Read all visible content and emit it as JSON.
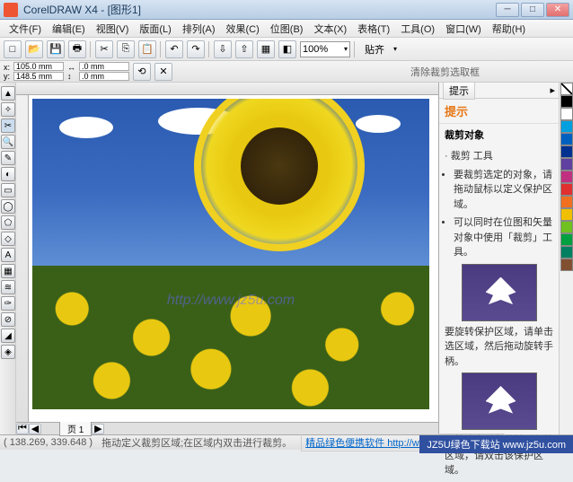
{
  "title": "CorelDRAW X4 - [图形1]",
  "menus": [
    "文件(F)",
    "编辑(E)",
    "视图(V)",
    "版面(L)",
    "排列(A)",
    "效果(C)",
    "位图(B)",
    "文本(X)",
    "表格(T)",
    "工具(O)",
    "窗口(W)",
    "帮助(H)"
  ],
  "zoom": "100%",
  "paste_label": "贴齐",
  "measures": {
    "x": "105.0 mm",
    "y": "148.5 mm",
    "w": ".0 mm",
    "h": ".0 mm"
  },
  "propbar_hint": "清除裁剪选取框",
  "page_tab": "页 1",
  "sidepanel": {
    "tab": "提示",
    "heading": "提示",
    "sub": "裁剪对象",
    "tool_line": "· 裁剪 工具",
    "items": [
      "要裁剪选定的对象，请拖动鼠标以定义保护区域。",
      "可以同时在位图和矢量对象中使用「裁剪」工具。"
    ],
    "text2": "要旋转保护区域，请单击选区域，然后拖动旋转手柄。",
    "text3": "要将选定对象裁剪到保护区域，请双击该保护区域。"
  },
  "status": {
    "coords": "( 138.269, 339.648 )",
    "hint": "拖动定义裁剪区域;在区域内双击进行裁剪。",
    "link_label": "精品绿色便携软件",
    "link_url": "http://www.portablesoft.cn"
  },
  "site_banner": "JZ5U绿色下载站 www.jz5u.com",
  "watermark": "http://www.jz5u.com",
  "palette": [
    "#ffffff",
    "#000000",
    "#003399",
    "#006633",
    "#cc0000",
    "#ff6600",
    "#ffcc00",
    "#66cc00",
    "#009999",
    "#3366cc",
    "#663399",
    "#cc3399",
    "#996633",
    "#666666",
    "#cccccc",
    "#ffcccc",
    "#ccffcc"
  ]
}
